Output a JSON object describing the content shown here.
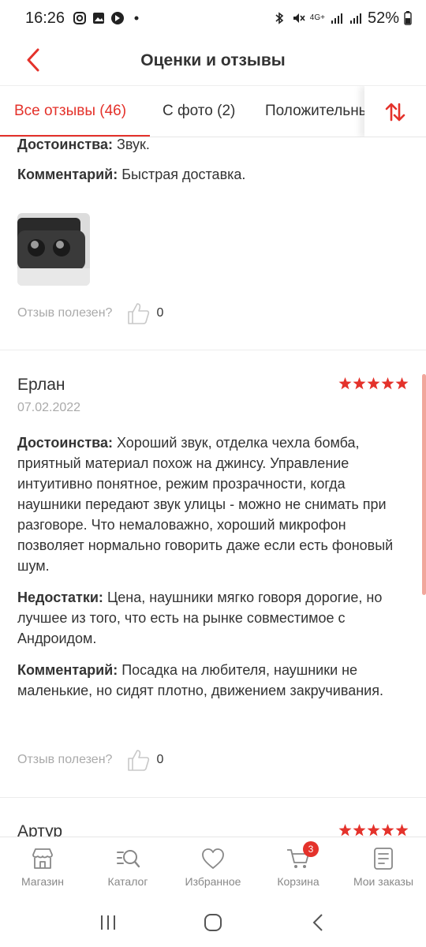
{
  "status_bar": {
    "time": "16:26",
    "battery": "52%",
    "network": "4G+"
  },
  "header": {
    "title": "Оценки и отзывы"
  },
  "tabs": {
    "all": "Все отзывы (46)",
    "photo": "С фото (2)",
    "positive": "Положительные"
  },
  "review_top": {
    "pros_label": "Достоинства:",
    "pros_text": "Звук.",
    "comment_label": "Комментарий:",
    "comment_text": "Быстрая доставка.",
    "helpful_label": "Отзыв полезен?",
    "helpful_count": "0"
  },
  "review_erlan": {
    "name": "Ерлан",
    "date": "07.02.2022",
    "rating": 5,
    "pros_label": "Достоинства:",
    "pros_text": "Хороший звук, отделка чехла бомба, приятный материал похож на джинсу. Управление интуитивно понятное, режим прозрачности, когда наушники передают звук улицы - можно не снимать при разговоре. Что немаловажно, хороший микрофон позволяет нормально говорить даже если есть фоновый шум.",
    "cons_label": "Недостатки:",
    "cons_text": "Цена, наушники мягко говоря дорогие, но лучшее из того, что есть на рынке совместимое с Андроидом.",
    "comment_label": "Комментарий:",
    "comment_text": "Посадка на любителя, наушники не маленькие, но сидят плотно, движением закручивания.",
    "helpful_label": "Отзыв полезен?",
    "helpful_count": "0"
  },
  "review_artur": {
    "name": "Артур",
    "rating": 5
  },
  "bottom_nav": {
    "shop": "Магазин",
    "catalog": "Каталог",
    "favorites": "Избранное",
    "cart": "Корзина",
    "cart_badge": "3",
    "orders": "Мои заказы"
  },
  "colors": {
    "accent": "#e4322b",
    "text": "#333333",
    "muted": "#aaaaaa"
  }
}
